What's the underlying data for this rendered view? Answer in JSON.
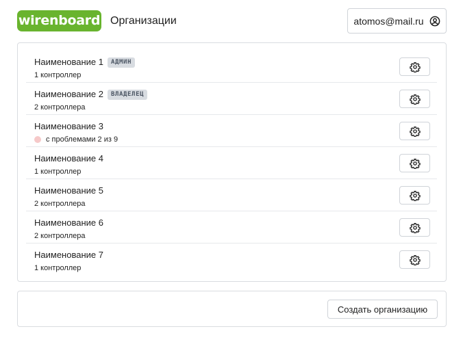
{
  "header": {
    "logo_text": "wirenboard",
    "title": "Организации",
    "user_email": "atomos@mail.ru",
    "user_icon": "account-circle-icon"
  },
  "organizations": [
    {
      "name": "Наименование 1",
      "badge": "АДМИН",
      "subtitle": "1 контроллер",
      "has_problem": false
    },
    {
      "name": "Наименование 2",
      "badge": "ВЛАДЕЛЕЦ",
      "subtitle": "2 контроллера",
      "has_problem": false
    },
    {
      "name": "Наименование 3",
      "badge": "",
      "subtitle": "с проблемами 2 из 9",
      "has_problem": true
    },
    {
      "name": "Наименование 4",
      "badge": "",
      "subtitle": "1 контроллер",
      "has_problem": false
    },
    {
      "name": "Наименование 5",
      "badge": "",
      "subtitle": "2 контроллера",
      "has_problem": false
    },
    {
      "name": "Наименование 6",
      "badge": "",
      "subtitle": "2 контроллера",
      "has_problem": false
    },
    {
      "name": "Наименование 7",
      "badge": "",
      "subtitle": "1 контроллер",
      "has_problem": false
    }
  ],
  "settings_icon": "gear-icon",
  "footer": {
    "create_label": "Создать организацию"
  },
  "colors": {
    "brand": "#69b42e",
    "badge_bg": "#d8dce1",
    "problem_dot": "#f6c9c9",
    "border": "#d9dce0"
  }
}
